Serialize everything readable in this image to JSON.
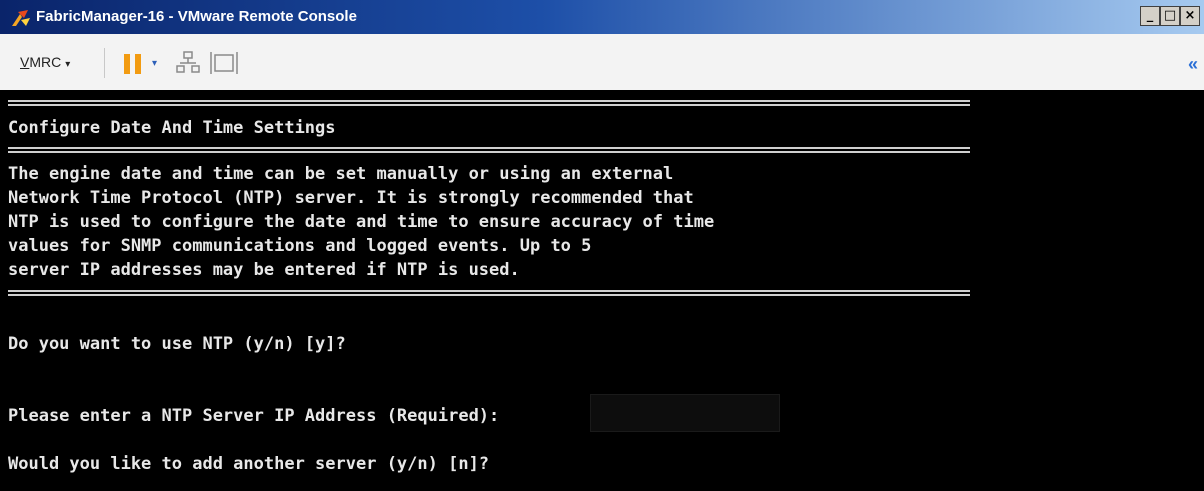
{
  "window": {
    "title": "FabricManager-16 - VMware Remote Console",
    "buttons": {
      "minimize": "_",
      "maximize": "□",
      "close": "×"
    }
  },
  "toolbar": {
    "vmrc_label_prefix": "V",
    "vmrc_label_rest": "MRC",
    "vmrc_caret": "▾",
    "pause_caret": "▾",
    "collapse": "«",
    "icons": [
      "pause-icon",
      "network-icon",
      "fit-screen-icon"
    ],
    "accent_color": "#f29b11"
  },
  "console": {
    "heading": "Configure Date And Time Settings",
    "intro_lines": [
      "The engine date and time can be set manually or using an external",
      "Network Time Protocol (NTP) server. It is strongly recommended that",
      "NTP is used to configure the date and time to ensure accuracy of time",
      "values for SNMP communications and logged events. Up to 5",
      "server IP addresses may be entered if NTP is used."
    ],
    "prompt_use_ntp": "Do you want to use NTP (y/n) [y]?",
    "prompt_server_ip": "Please enter a NTP Server IP Address (Required):",
    "prompt_add_server": "Would you like to add another server (y/n) [n]?"
  }
}
